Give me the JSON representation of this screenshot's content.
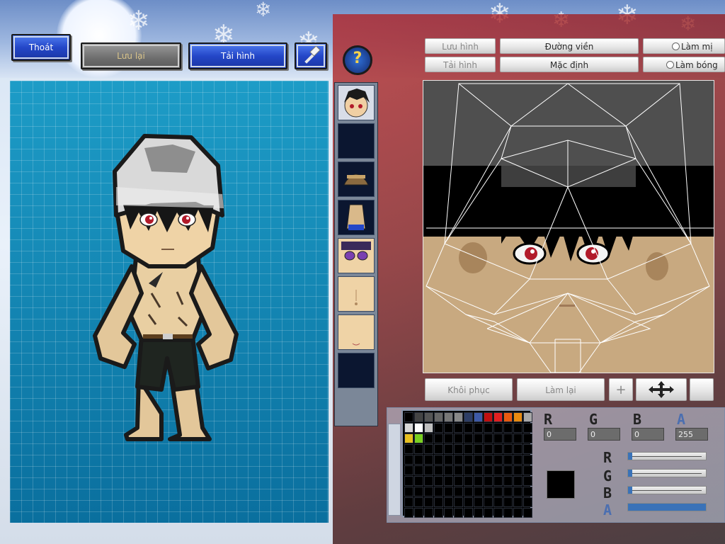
{
  "toolbar": {
    "exit_label": "Thoát",
    "save_label": "Lưu lại",
    "reload_label": "Tải hình",
    "hammer_icon": "hammer-icon",
    "help_label": "?"
  },
  "texture_toolbar": {
    "save_image_label": "Lưu hình",
    "load_image_label": "Tải hình",
    "border_label": "Đường viền",
    "default_label": "Mặc định",
    "blur_label": "Làm mị",
    "shade_label": "Làm bóng"
  },
  "texture_actions": {
    "restore_label": "Khôi phục",
    "redo_label": "Làm lại",
    "plus_label": "+",
    "move_icon": "move-arrows-icon"
  },
  "parts": [
    {
      "name": "face",
      "filled": true
    },
    {
      "name": "empty-1",
      "filled": false
    },
    {
      "name": "hat",
      "filled": true
    },
    {
      "name": "body",
      "filled": true
    },
    {
      "name": "eyes",
      "filled": true
    },
    {
      "name": "torso",
      "filled": true
    },
    {
      "name": "head-skin",
      "filled": true
    },
    {
      "name": "empty-2",
      "filled": false
    }
  ],
  "color": {
    "r_label": "R",
    "g_label": "G",
    "b_label": "B",
    "a_label": "A",
    "r": "0",
    "g": "0",
    "b": "0",
    "a": "255",
    "selected_hex": "#000000",
    "slider_levels": {
      "r": 0.0,
      "g": 0.0,
      "b": 0.0,
      "a": 1.0
    },
    "palette": [
      "#000000",
      "#444444",
      "#555555",
      "#666666",
      "#777777",
      "#888888",
      "#2e3e66",
      "#3e5aa6",
      "#c01010",
      "#e02020",
      "#e85a10",
      "#e88a10",
      "#a8a8a8",
      "#d8d8d8",
      "#ffffff",
      "#bfbfbf",
      "#000000",
      "#000000",
      "#000000",
      "#000000",
      "#000000",
      "#000000",
      "#000000",
      "#000000",
      "#000000",
      "#000000",
      "#e8c020",
      "#7ad020",
      "#000000"
    ]
  }
}
